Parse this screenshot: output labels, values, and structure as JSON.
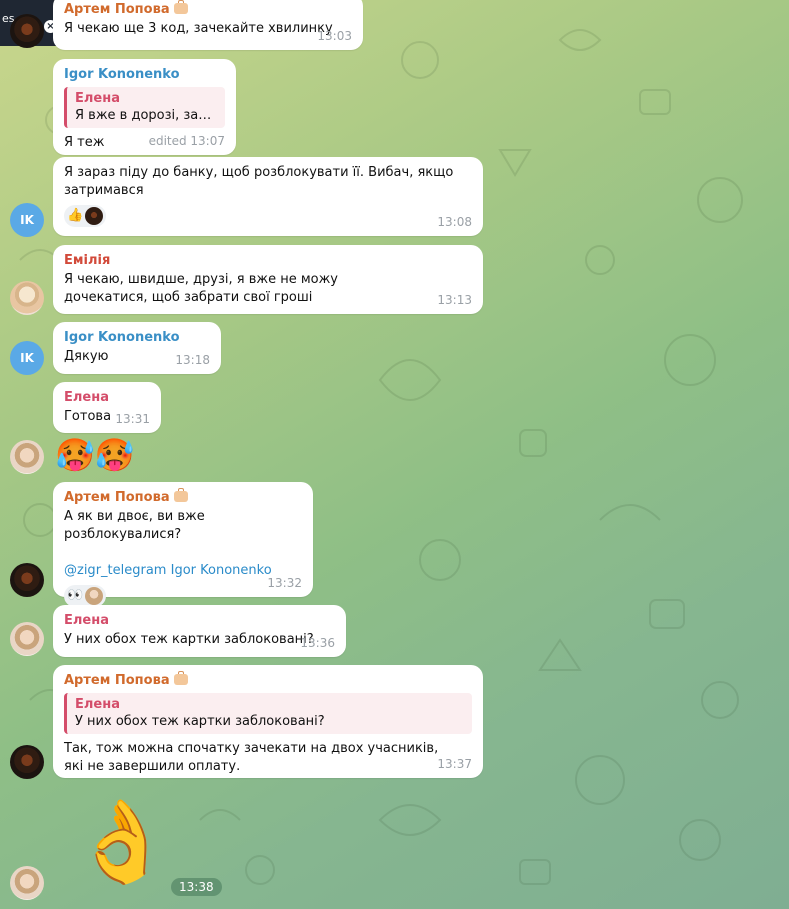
{
  "top_pill": {
    "label": "es",
    "close_icon": "×"
  },
  "messages": [
    {
      "id": "m1",
      "name": "Артем Попова",
      "name_color": "#d16a2c",
      "text": "Я чекаю ще 3 код, зачекайте хвилинку",
      "time": "13:03"
    },
    {
      "id": "m2",
      "name": "Igor Kononenko",
      "name_color": "#3a8fc6",
      "quote_name": "Елена",
      "quote_text": "Я вже в дорозі, зачек...",
      "text": "Я теж",
      "time": "edited 13:07"
    },
    {
      "id": "m3",
      "text": "Я зараз піду до банку, щоб розблокувати її. Вибач, якщо затримався",
      "time": "13:08",
      "reaction_emoji": "👍",
      "avatar_initials": "IK"
    },
    {
      "id": "m4",
      "name": "Емілія",
      "name_color": "#d24a3a",
      "text": "Я чекаю, швидше, друзі, я вже не можу дочекатися, щоб забрати свої гроші",
      "time": "13:13"
    },
    {
      "id": "m5",
      "name": "Igor Kononenko",
      "name_color": "#3a8fc6",
      "text": "Дякую",
      "time": "13:18",
      "avatar_initials": "IK"
    },
    {
      "id": "m6",
      "name": "Елена",
      "name_color": "#d44d6a",
      "text": "Готова",
      "time": "13:31"
    },
    {
      "id": "m7",
      "emojis": "🥵🥵"
    },
    {
      "id": "m8",
      "name": "Артем Попова",
      "name_color": "#d16a2c",
      "text": "А як ви двоє, ви вже розблокувалися?",
      "mention1": "@zigr_telegram",
      "mention2": "Igor Kononenko",
      "time": "13:32",
      "reaction_emoji": "👀"
    },
    {
      "id": "m9",
      "name": "Елена",
      "name_color": "#d44d6a",
      "text": "У них обох теж картки заблоковані?",
      "time": "13:36"
    },
    {
      "id": "m10",
      "name": "Артем Попова",
      "name_color": "#d16a2c",
      "quote_name": "Елена",
      "quote_text": "У них обох теж картки заблоковані?",
      "text": "Так, тож можна спочатку зачекати на двох учасників, які не завершили оплату.",
      "time": "13:37"
    },
    {
      "id": "m11",
      "sticker": "👌",
      "time": "13:38"
    }
  ]
}
